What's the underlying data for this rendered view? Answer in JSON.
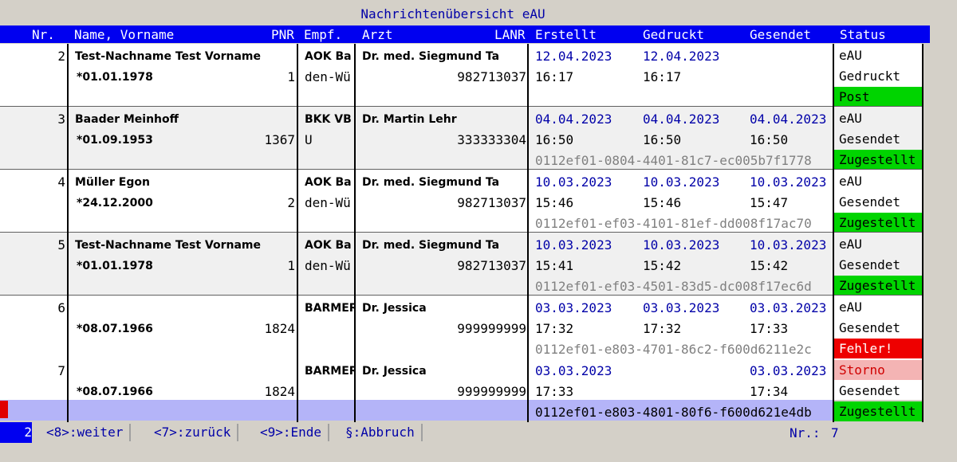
{
  "window": {
    "title": "Nachrichtenübersicht eAU"
  },
  "columns": {
    "nr": "Nr.",
    "name": "Name, Vorname",
    "pnr": "PNR",
    "empf": "Empf.",
    "arzt": "Arzt",
    "lanr": "LANR",
    "erstellt": "Erstellt",
    "gedruckt": "Gedruckt",
    "gesendet": "Gesendet",
    "status": "Status"
  },
  "rows": [
    {
      "nr": "2",
      "name": "Test-Nachname Test Vorname",
      "birth": "*01.01.1978",
      "pnr": "1",
      "empf1": "AOK Ba",
      "empf2": "den-Wü",
      "arzt": "Dr. med. Siegmund Ta",
      "lanr": "982713037",
      "erstellt_date": "12.04.2023",
      "erstellt_time": "16:17",
      "gedruckt_date": "12.04.2023",
      "gedruckt_time": "16:17",
      "gesendet_date": "",
      "gesendet_time": "",
      "guid": "",
      "status1": "eAU",
      "status2": "Gedruckt",
      "status3": "Post"
    },
    {
      "nr": "3",
      "name": "Baader Meinhoff",
      "birth": "*01.09.1953",
      "pnr": "1367",
      "empf1": "BKK VB",
      "empf2": "U",
      "arzt": "Dr. Martin Lehr",
      "lanr": "333333304",
      "erstellt_date": "04.04.2023",
      "erstellt_time": "16:50",
      "gedruckt_date": "04.04.2023",
      "gedruckt_time": "16:50",
      "gesendet_date": "04.04.2023",
      "gesendet_time": "16:50",
      "guid": "0112ef01-0804-4401-81c7-ec005b7f1778",
      "status1": "eAU",
      "status2": "Gesendet",
      "status3": "Zugestellt"
    },
    {
      "nr": "4",
      "name": "Müller Egon",
      "birth": "*24.12.2000",
      "pnr": "2",
      "empf1": "AOK Ba",
      "empf2": "den-Wü",
      "arzt": "Dr. med. Siegmund Ta",
      "lanr": "982713037",
      "erstellt_date": "10.03.2023",
      "erstellt_time": "15:46",
      "gedruckt_date": "10.03.2023",
      "gedruckt_time": "15:46",
      "gesendet_date": "10.03.2023",
      "gesendet_time": "15:47",
      "guid": "0112ef01-ef03-4101-81ef-dd008f17ac70",
      "status1": "eAU",
      "status2": "Gesendet",
      "status3": "Zugestellt"
    },
    {
      "nr": "5",
      "name": "Test-Nachname Test Vorname",
      "birth": "*01.01.1978",
      "pnr": "1",
      "empf1": "AOK Ba",
      "empf2": "den-Wü",
      "arzt": "Dr. med. Siegmund Ta",
      "lanr": "982713037",
      "erstellt_date": "10.03.2023",
      "erstellt_time": "15:41",
      "gedruckt_date": "10.03.2023",
      "gedruckt_time": "15:42",
      "gesendet_date": "10.03.2023",
      "gesendet_time": "15:42",
      "guid": "0112ef01-ef03-4501-83d5-dc008f17ec6d",
      "status1": "eAU",
      "status2": "Gesendet",
      "status3": "Zugestellt"
    },
    {
      "nr": "6",
      "name": "",
      "birth": "*08.07.1966",
      "pnr": "1824",
      "empf1": "BARMER",
      "empf2": "",
      "arzt": "Dr. Jessica",
      "lanr": "999999999",
      "erstellt_date": "03.03.2023",
      "erstellt_time": "17:32",
      "gedruckt_date": "03.03.2023",
      "gedruckt_time": "17:32",
      "gesendet_date": "03.03.2023",
      "gesendet_time": "17:33",
      "guid": "0112ef01-e803-4701-86c2-f600d6211e2c",
      "status1": "eAU",
      "status2": "Gesendet",
      "status3": "Fehler!"
    },
    {
      "nr": "7",
      "name": "",
      "birth": "*08.07.1966",
      "pnr": "1824",
      "empf1": "BARMER",
      "empf2": "",
      "arzt": "Dr. Jessica",
      "lanr": "999999999",
      "erstellt_date": "03.03.2023",
      "erstellt_time": "17:33",
      "gedruckt_date": "",
      "gedruckt_time": "",
      "gesendet_date": "03.03.2023",
      "gesendet_time": "17:34",
      "guid": "0112ef01-e803-4801-80f6-f600d621e4db",
      "status1": "Storno",
      "status2": "Gesendet",
      "status3": "Zugestellt"
    }
  ],
  "footer": {
    "page": "2",
    "keys": [
      "<8>:weiter",
      "<7>:zurück",
      "<9>:Ende",
      "§:Abbruch"
    ],
    "count_label": "Nr.:",
    "count_value": "7"
  },
  "colors": {
    "header_bg": "#0000f0",
    "ok_green": "#00d400",
    "error_red": "#ee0000",
    "storno_pink": "#f4b4b4",
    "selection": "#b4b4f8"
  }
}
